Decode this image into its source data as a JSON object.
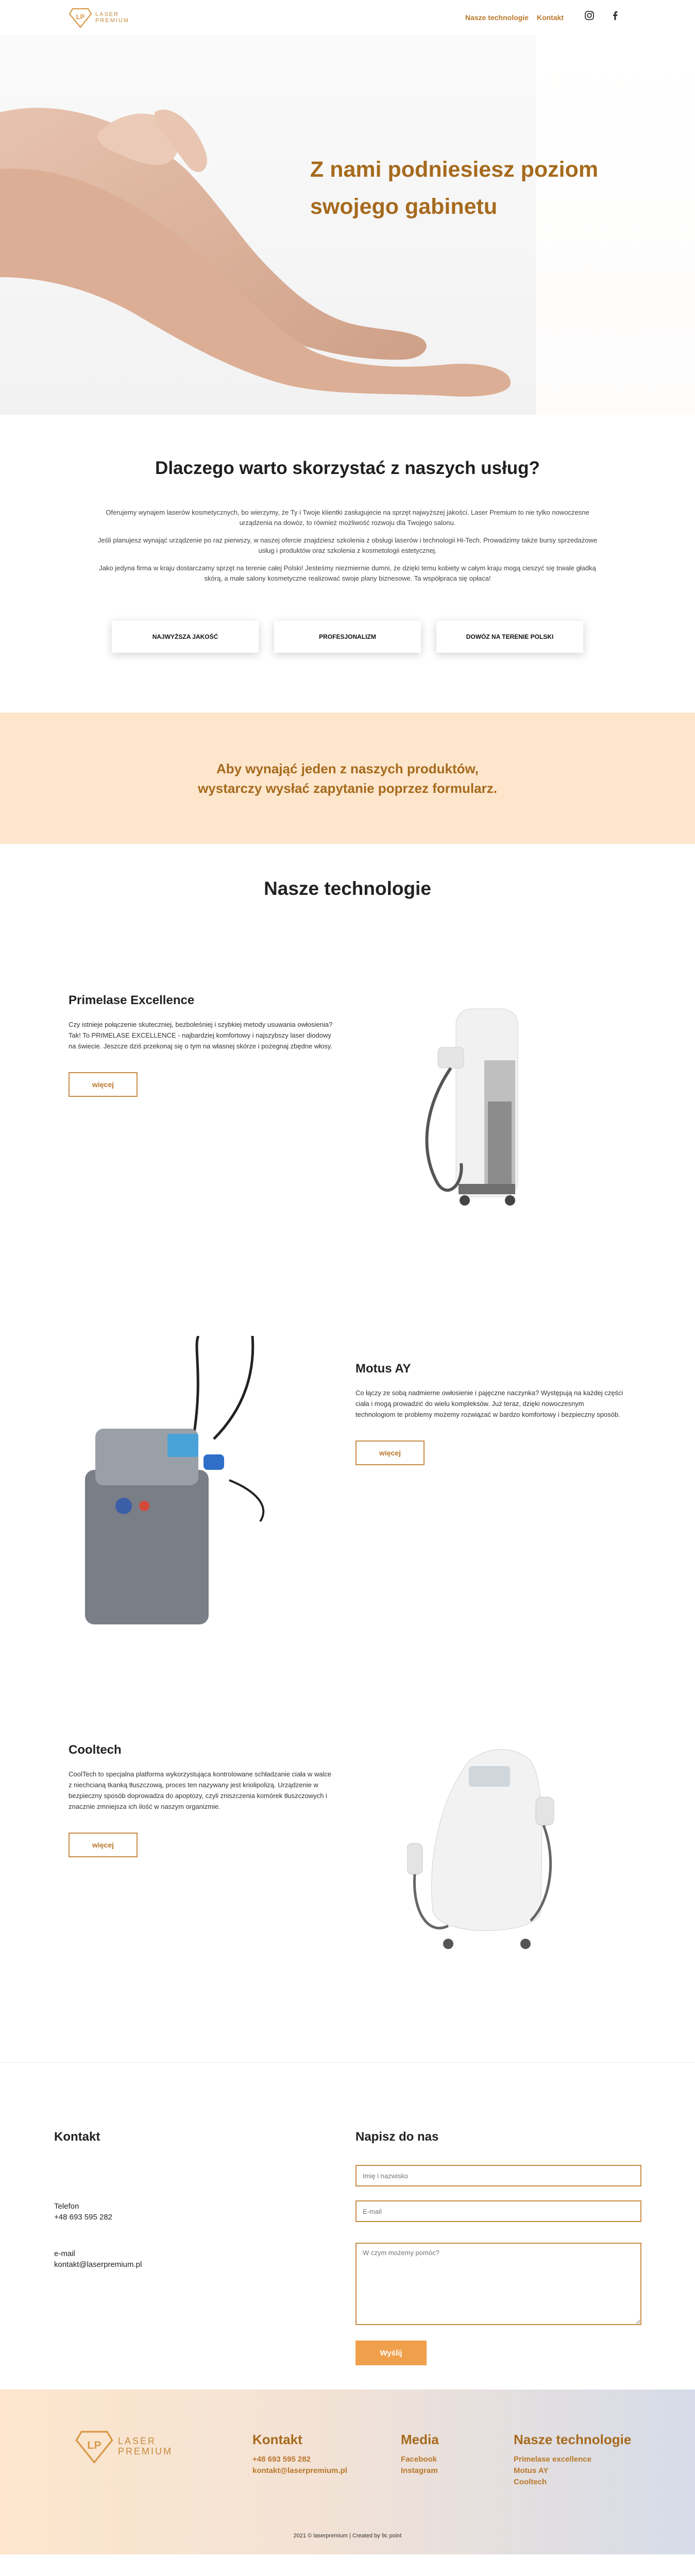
{
  "brand": {
    "logo_line1": "LASER",
    "logo_line2": "PREMIUM",
    "logo_letters": "LP",
    "accent": "#b9782b",
    "dark_accent": "#a66a1d",
    "peach": "#fde6cc"
  },
  "nav": {
    "item1": "Nasze technologie",
    "item2": "Kontakt"
  },
  "social": {
    "icon1": "instagram-icon",
    "icon2": "facebook-icon"
  },
  "hero": {
    "title_line1": "Z nami podniesiesz poziom",
    "title_line2": "swojego gabinetu"
  },
  "why": {
    "heading": "Dlaczego warto skorzystać z naszych usług?",
    "p1": "Oferujemy wynajem laserów kosmetycznych, bo wierzymy, że Ty i Twoje klientki zasługujecie na sprzęt najwyższej jakości. Laser Premium to nie tylko nowoczesne urządzenia na dowóz, to również możliwość rozwoju dla Twojego salonu.",
    "p2": "Jeśli planujesz wynająć urządzenie po raz pierwszy, w naszej ofercie znajdziesz szkolenia z obsługi laserów i technologii Hi-Tech. Prowadzimy także bursy sprzedażowe usług i produktów oraz szkolenia z kosmetologii estetycznej.",
    "p3": "Jako jedyna firma w kraju dostarczamy sprzęt na terenie całej Polski! Jesteśmy niezmiernie dumni, że dzięki temu kobiety w całym kraju mogą cieszyć się trwale gładką skórą, a małe salony kosmetyczne realizować swoje plany biznesowe. Ta współpraca się opłaca!",
    "features": [
      "NAJWYŻSZA JAKOŚĆ",
      "PROFESJONALIZM",
      "DOWÓZ NA TERENIE POLSKI"
    ]
  },
  "banner": {
    "line1": "Aby wynająć jeden z naszych produktów,",
    "line2": "wystarczy wysłać zapytanie poprzez formularz."
  },
  "tech": {
    "title": "Nasze technologie",
    "more": "więcej",
    "items": [
      {
        "name": "Primelase Excellence",
        "desc": "Czy istnieje połączenie skuteczniej, bezboleśniej i szybkiej metody usuwania owłosienia? Tak! To PRIMELASE EXCELLENCE - najbardziej komfortowy i najszybszy laser diodowy na świecie. Jeszcze dziś przekonaj się o tym na własnej skórze i pożegnaj zbędne włosy."
      },
      {
        "name": "Motus AY",
        "desc": "Co łączy ze sobą nadmierne owłosienie i pajęczne naczynka? Występują na każdej części ciała i mogą prowadzić do wielu kompleksów. Już teraz, dzięki nowoczesnym technologiom te problemy możemy rozwiązać w bardzo komfortowy i bezpieczny sposób."
      },
      {
        "name": "Cooltech",
        "desc": "CoolTech to specjalna platforma wykorzystująca kontrolowane schładzanie ciała w walce z niechcianą tkanką tłuszczową, proces ten nazywany jest kriolipolizą. Urządzenie w bezpieczny sposób doprowadza do apoptozy, czyli zniszczenia komórek tłuszczowych i znacznie zmniejsza ich ilość w naszym organizmie."
      }
    ]
  },
  "contact": {
    "heading": "Kontakt",
    "phone_label": "Telefon",
    "phone": "+48 693 595 282",
    "email_label": "e-mail",
    "email": "kontakt@laserpremium.pl",
    "form_heading": "Napisz do nas",
    "name_placeholder": "Imię i nazwisko",
    "email_placeholder": "E-mail",
    "message_placeholder": "W czym możemy pomóc?",
    "send": "Wyślij"
  },
  "footer": {
    "col1_title": "Kontakt",
    "col1_l1": "+48 693 595 282",
    "col1_l2": "kontakt@laserpremium.pl",
    "col2_title": "Media",
    "col2_l1": "Facebook",
    "col2_l2": "Instagram",
    "col3_title": "Nasze technologie",
    "col3_l1": "Primelase excellence",
    "col3_l2": "Motus AY",
    "col3_l3": "Cooltech",
    "copyright": "2021 © laserpremium | Created by 9c point"
  }
}
